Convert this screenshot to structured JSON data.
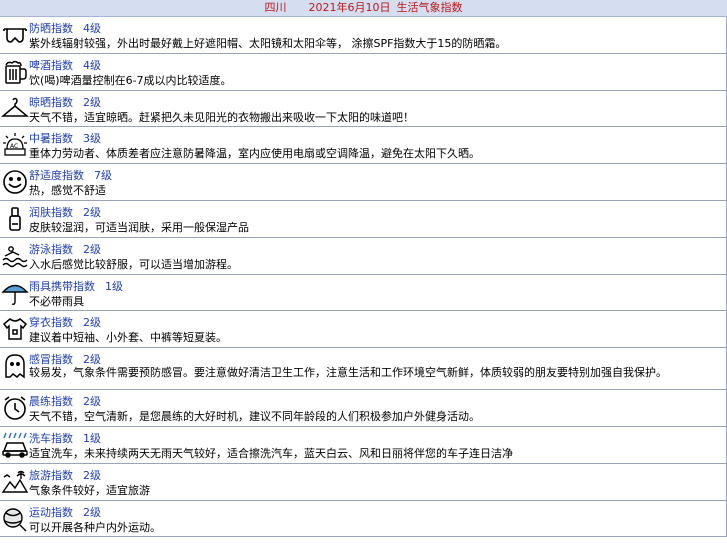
{
  "header": {
    "region": "四川",
    "date": "2021年6月10日",
    "title": "生活气象指数"
  },
  "items": [
    {
      "name": "防晒指数",
      "level": "4级",
      "desc": "紫外线辐射较强，外出时最好戴上好遮阳帽、太阳镜和太阳伞等， 涂擦SPF指数大于15的防晒霜。",
      "icon": "sunglasses-icon"
    },
    {
      "name": "啤酒指数",
      "level": "4级",
      "desc": "饮(喝)啤酒量控制在6-7成以内比较适度。",
      "icon": "beer-mug-icon"
    },
    {
      "name": "晾晒指数",
      "level": "2级",
      "desc": "天气不错，适宜晾晒。赶紧把久未见阳光的衣物搬出来吸收一下太阳的味道吧！",
      "icon": "hanger-icon"
    },
    {
      "name": "中暑指数",
      "level": "3级",
      "desc": "重体力劳动者、体质差者应注意防暑降温，室内应使用电扇或空调降温，避免在太阳下久晒。",
      "icon": "heatstroke-icon"
    },
    {
      "name": "舒适度指数",
      "level": "7级",
      "desc": "热，感觉不舒适",
      "icon": "smiley-face-icon"
    },
    {
      "name": "润肤指数",
      "level": "2级",
      "desc": "皮肤较湿润，可适当润肤，采用一般保湿产品",
      "icon": "lotion-bottle-icon"
    },
    {
      "name": "游泳指数",
      "level": "2级",
      "desc": "入水后感觉比较舒服，可以适当增加游程。",
      "icon": "swimmer-icon"
    },
    {
      "name": "雨具携带指数",
      "level": "1级",
      "desc": "不必带雨具",
      "icon": "umbrella-icon"
    },
    {
      "name": "穿衣指数",
      "level": "2级",
      "desc": "建议着中短袖、小外套、中裤等短夏装。",
      "icon": "tshirt-icon"
    },
    {
      "name": "感冒指数",
      "level": "2级",
      "desc": "较易发，气象条件需要预防感冒。要注意做好清洁卫生工作，注意生活和工作环境空气新鲜，体质较弱的朋友要特别加强自我保护。",
      "icon": "ghost-icon"
    },
    {
      "name": "晨练指数",
      "level": "2级",
      "desc": "天气不错，空气清新，是您晨练的大好时机，建议不同年龄段的人们积极参加户外健身活动。",
      "icon": "alarm-clock-icon"
    },
    {
      "name": "洗车指数",
      "level": "1级",
      "desc": "适宜洗车，未来持续两天无雨天气较好，适合擦洗汽车，蓝天白云、风和日丽将伴您的车子连日洁净",
      "icon": "car-wash-icon"
    },
    {
      "name": "旅游指数",
      "level": "2级",
      "desc": "气象条件较好，适宜旅游",
      "icon": "travel-landscape-icon"
    },
    {
      "name": "运动指数",
      "level": "2级",
      "desc": "可以开展各种户内外运动。",
      "icon": "sports-ball-icon"
    }
  ]
}
